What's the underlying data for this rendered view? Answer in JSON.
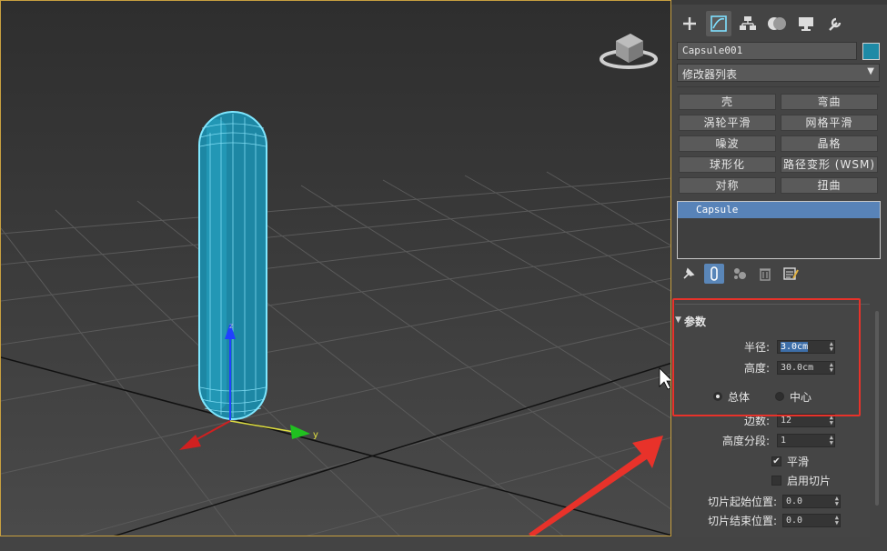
{
  "viewport": {
    "axis_labels": {
      "z": "z",
      "y": "y"
    },
    "colors": {
      "capsule": "#1d87a4",
      "wire": "#7fe7ff",
      "grid": "#5a5a5a",
      "axis_z": "#2040ff",
      "axis_y": "#20c020",
      "axis_x": "#d02020",
      "annotation": "#e8322a"
    }
  },
  "panel": {
    "tabs": [
      {
        "name": "create-tab",
        "icon": "plus-icon"
      },
      {
        "name": "modify-tab",
        "icon": "modify-icon"
      },
      {
        "name": "hierarchy-tab",
        "icon": "hierarchy-icon"
      },
      {
        "name": "motion-tab",
        "icon": "motion-icon"
      },
      {
        "name": "display-tab",
        "icon": "display-icon"
      },
      {
        "name": "utilities-tab",
        "icon": "wrench-icon"
      }
    ],
    "object_name": "Capsule001",
    "object_color": "#1e8aa6",
    "modifier_list": "修改器列表",
    "modifier_buttons": [
      "壳",
      "弯曲",
      "涡轮平滑",
      "网格平滑",
      "噪波",
      "晶格",
      "球形化",
      "路径变形 (WSM)",
      "对称",
      "扭曲"
    ],
    "stack_items": [
      "Capsule"
    ],
    "rollout": {
      "title": "参数",
      "radius_label": "半径:",
      "radius_value": "3.0cm",
      "height_label": "高度:",
      "height_value": "30.0cm",
      "radio_overall": "总体",
      "radio_center": "中心",
      "sides_label": "边数:",
      "sides_value": "12",
      "height_segs_label": "高度分段:",
      "height_segs_value": "1",
      "smooth_label": "平滑",
      "slice_on_label": "启用切片",
      "slice_from_label": "切片起始位置:",
      "slice_from_value": "0.0",
      "slice_to_label": "切片结束位置:",
      "slice_to_value": "0.0"
    }
  }
}
